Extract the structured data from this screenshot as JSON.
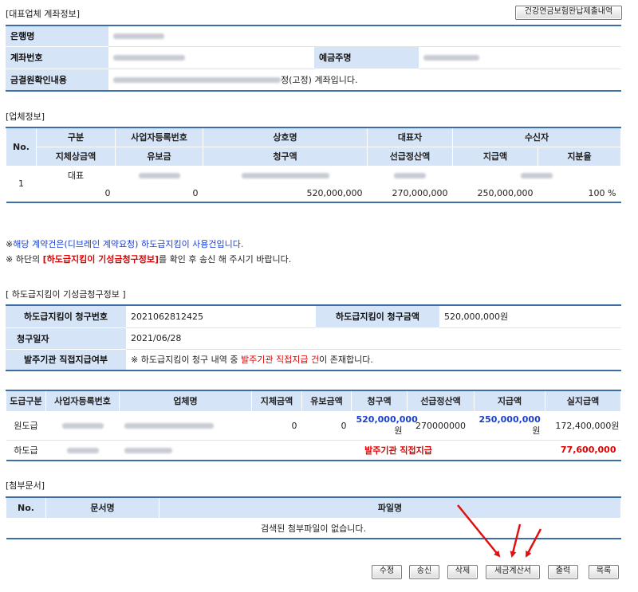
{
  "account": {
    "section_title": "[대표업체 계좌정보]",
    "pension_button": "건강연금보험완납제출내역",
    "bank_label": "은행명",
    "account_label": "계좌번호",
    "holder_label": "예금주명",
    "confirm_label": "금결원확인내용",
    "confirm_value": "정(고정) 계좌입니다."
  },
  "company": {
    "section_title": "[업체정보]",
    "headers_top": [
      "No.",
      "구분",
      "사업자등록번호",
      "상호명",
      "대표자",
      "수신자"
    ],
    "headers_bottom": [
      "지체상금액",
      "유보금",
      "청구액",
      "선급정산액",
      "지급액",
      "지분율"
    ],
    "row": {
      "no": "1",
      "type": "대표",
      "delay": "0",
      "reserve": "0",
      "claim": "520,000,000",
      "advance": "270,000,000",
      "pay": "250,000,000",
      "share": "100 %"
    }
  },
  "notice": {
    "line1_prefix": "※",
    "line1_text": "해당 계약건은(디브레인 계약요청) 하도급지킴이 사용건입니다.",
    "line2_prefix": "※ 하단의 ",
    "line2_highlight": "[하도급지킴이 기성금청구정보]",
    "line2_suffix": "를 확인 후 송신 해 주시기 바랍니다."
  },
  "subcontract": {
    "section_title": "[ 하도급지킴이 기성금청구정보 ]",
    "claim_no_label": "하도급지킴이 청구번호",
    "claim_no_value": "2021062812425",
    "claim_amount_label": "하도급지킴이 청구금액",
    "claim_amount_value": "520,000,000원",
    "claim_date_label": "청구일자",
    "claim_date_value": "2021/06/28",
    "direct_label": "발주기관 직접지급여부",
    "direct_prefix": "※ 하도급지킴이 청구 내역 중 ",
    "direct_highlight": "발주기관 직접지급 건",
    "direct_suffix": "이 존재합니다."
  },
  "payments": {
    "headers": [
      "도급구분",
      "사업자등록번호",
      "업체명",
      "지체금액",
      "유보금액",
      "청구액",
      "선급정산액",
      "지급액",
      "실지급액"
    ],
    "row1": {
      "type": "원도급",
      "delay": "0",
      "reserve": "0",
      "claim": "520,000,000",
      "claim_unit": "원",
      "advance": "270000000",
      "pay": "250,000,000",
      "pay_unit": "원",
      "actual": "172,400,000원"
    },
    "row2": {
      "type": "하도급",
      "direct": "발주기관 직접지급",
      "actual": "77,600,000"
    }
  },
  "attachments": {
    "section_title": "[첨부문서]",
    "headers": [
      "No.",
      "문서명",
      "파일명"
    ],
    "empty": "검색된 첨부파일이 없습니다."
  },
  "buttons": {
    "edit": "수정",
    "send": "송신",
    "delete": "삭제",
    "tax": "세금계산서",
    "print": "출력",
    "list": "목록"
  }
}
